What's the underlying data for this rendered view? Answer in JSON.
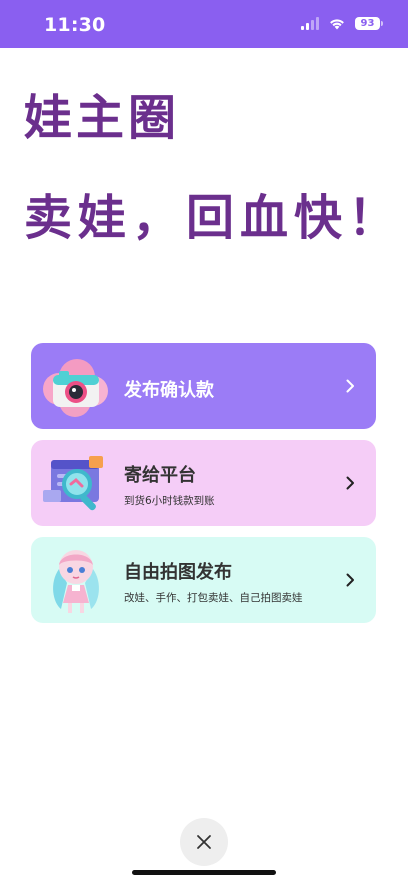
{
  "status_bar": {
    "time": "11:30",
    "battery": "93",
    "background_color": "#8a5ff0"
  },
  "hero": {
    "line1": "娃主圈",
    "line2": "卖娃，回血快！",
    "color": "#6b2f8d"
  },
  "cards": [
    {
      "title": "发布确认款",
      "subtitle": "",
      "illustration": "pink-camera-icon",
      "background": "#9b7cf6"
    },
    {
      "title": "寄给平台",
      "subtitle": "到货6小时钱款到账",
      "illustration": "magnifier-window-icon",
      "background": "#f5cdf7"
    },
    {
      "title": "自由拍图发布",
      "subtitle": "改娃、手作、打包卖娃、自己拍图卖娃",
      "illustration": "doll-figure-icon",
      "background": "#d7fbf4"
    }
  ],
  "close_icon": "close-icon"
}
